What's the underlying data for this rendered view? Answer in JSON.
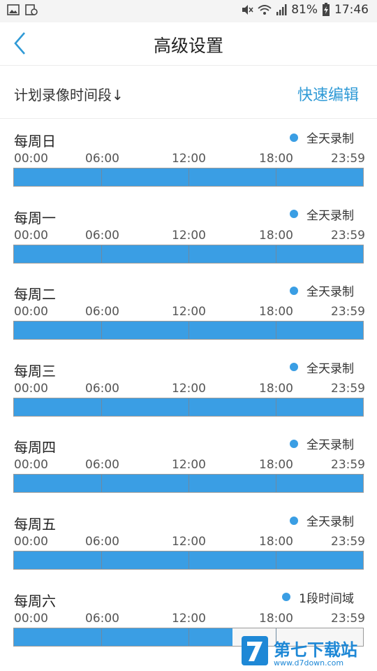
{
  "status_bar": {
    "battery_percent": "81%",
    "time": "17:46"
  },
  "nav": {
    "title": "高级设置"
  },
  "schedule": {
    "header": "计划录像时间段↓",
    "quick_edit": "快速编辑"
  },
  "time_labels": [
    "00:00",
    "06:00",
    "12:00",
    "18:00",
    "23:59"
  ],
  "days": [
    {
      "name": "每周日",
      "status": "全天录制",
      "fill_fraction": 1.0
    },
    {
      "name": "每周一",
      "status": "全天录制",
      "fill_fraction": 1.0
    },
    {
      "name": "每周二",
      "status": "全天录制",
      "fill_fraction": 1.0
    },
    {
      "name": "每周三",
      "status": "全天录制",
      "fill_fraction": 1.0
    },
    {
      "name": "每周四",
      "status": "全天录制",
      "fill_fraction": 1.0
    },
    {
      "name": "每周五",
      "status": "全天录制",
      "fill_fraction": 1.0
    },
    {
      "name": "每周六",
      "status": "1段时间域",
      "fill_fraction": 0.625
    }
  ],
  "watermark": {
    "text": "第七下载站",
    "url": "www.d7down.com"
  },
  "colors": {
    "accent": "#2f9ad6",
    "timeline_fill": "#3a9ee4",
    "status_dot": "#3a9ee4"
  }
}
